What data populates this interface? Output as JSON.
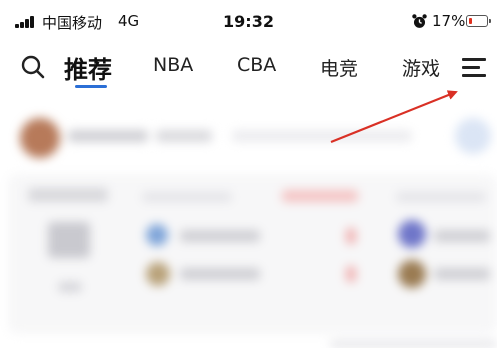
{
  "status_bar": {
    "carrier": "中国移动",
    "network": "4G",
    "time": "19:32",
    "battery_percent": "17%",
    "battery_level": 0.17,
    "icons": [
      "signal-bars-icon",
      "alarm-clock-icon",
      "battery-icon"
    ]
  },
  "top_nav": {
    "search_icon": "search-icon",
    "tabs": [
      {
        "label": "推荐",
        "active": true
      },
      {
        "label": "NBA",
        "active": false
      },
      {
        "label": "CBA",
        "active": false
      },
      {
        "label": "电竞",
        "active": false
      },
      {
        "label": "游戏",
        "active": false
      }
    ],
    "menu_icon": "hamburger-menu-icon",
    "indicator_color": "#2b6fd6"
  },
  "annotation": {
    "arrow_color": "#d93025",
    "points_to": "hamburger-menu-icon"
  }
}
